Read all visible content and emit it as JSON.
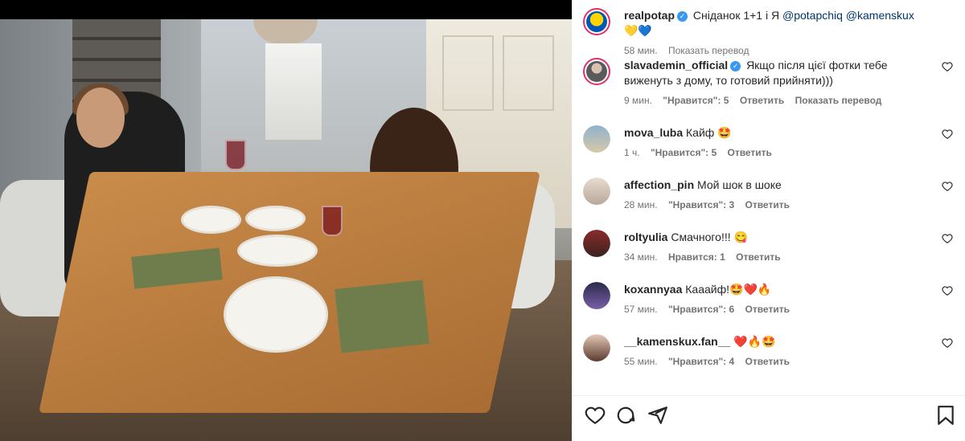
{
  "post": {
    "author": "realpotap",
    "caption_text": "Сніданок 1+1 і Я ",
    "mention_1": "@potapchiq",
    "mention_2": "@kamenskux",
    "emoji": "💛💙",
    "time": "58 мин.",
    "translate": "Показать перевод"
  },
  "comments": [
    {
      "user": "slavademin_official",
      "verified": true,
      "text": "Якщо після цієї фотки тебе виженуть з дому, то готовий прийняти)))",
      "time": "9 мин.",
      "likes": "\"Нравится\": 5",
      "reply": "Ответить",
      "translate": "Показать перевод"
    },
    {
      "user": "mova_luba",
      "text": "Кайф 🤩",
      "time": "1 ч.",
      "likes": "\"Нравится\": 5",
      "reply": "Ответить"
    },
    {
      "user": "affection_pin",
      "text": "Мой шок в шоке",
      "time": "28 мин.",
      "likes": "\"Нравится\": 3",
      "reply": "Ответить"
    },
    {
      "user": "roltyulia",
      "text": "Смачного!!! 😋",
      "time": "34 мин.",
      "likes": "Нравится: 1",
      "reply": "Ответить"
    },
    {
      "user": "koxannyaa",
      "text": "Кааайф!🤩❤️🔥",
      "time": "57 мин.",
      "likes": "\"Нравится\": 6",
      "reply": "Ответить"
    },
    {
      "user": "__kamenskux.fan__",
      "text": "❤️🔥🤩",
      "time": "55 мин.",
      "likes": "\"Нравится\": 4",
      "reply": "Ответить"
    }
  ],
  "icons": {
    "like": "heart-icon",
    "comment": "comment-icon",
    "share": "share-icon",
    "save": "bookmark-icon"
  },
  "colors": {
    "verified": "#3897f0",
    "mention": "#00376b",
    "meta": "#737373"
  }
}
